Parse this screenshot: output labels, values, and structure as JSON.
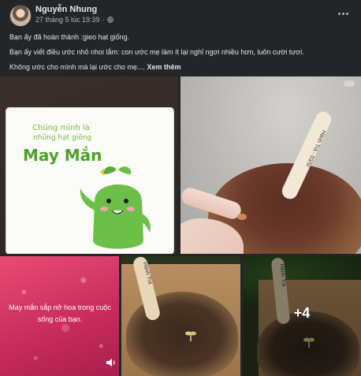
{
  "post": {
    "author": "Nguyễn Nhung",
    "timestamp": "27 tháng 5 lúc 19:39",
    "separator": "·",
    "privacy_icon": "globe-icon",
    "more_icon": "more-horizontal-icon",
    "text_lines": [
      "Bạn ấy đã hoàn thành :gieo hạt giống.",
      "Bạn ấy viết điều ước nhỏ nhoi lắm: con ước mẹ làm ít lại nghỉ ngơi nhiều hơn, luôn cười tươi.",
      "Không ước cho mình mà lại ước cho mẹ.... "
    ],
    "see_more": "Xem thêm"
  },
  "photos": {
    "card": {
      "line1": "Chúng mình là",
      "line2": "những hạt giống",
      "brand": "May Mắn"
    },
    "stick_label": "Hành Trà - 03/5/",
    "stick_label_short": "Hành Trà",
    "pink_text": "May mắn sắp nở hoa trong cuộc sống của bạn.",
    "speaker_icon": "speaker-icon",
    "more_count": "+4"
  },
  "colors": {
    "background": "#242526",
    "text": "#e4e6eb",
    "secondary_text": "#b0b3b8",
    "brand_green": "#4ea12d",
    "pink": "#e94b74"
  }
}
